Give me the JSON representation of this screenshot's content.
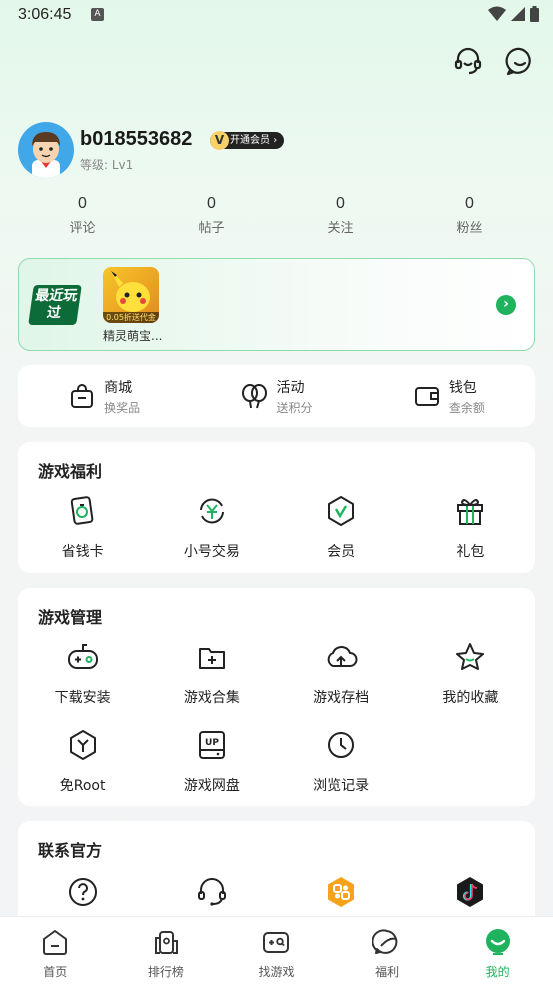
{
  "status": {
    "time": "3:06:45",
    "a_icon": "A"
  },
  "profile": {
    "username": "b018553682",
    "vip_label": "开通会员",
    "level": "等级: Lv1"
  },
  "stats": [
    {
      "value": "0",
      "label": "评论"
    },
    {
      "value": "0",
      "label": "帖子"
    },
    {
      "value": "0",
      "label": "关注"
    },
    {
      "value": "0",
      "label": "粉丝"
    }
  ],
  "recent": {
    "logo_text": "最近玩过",
    "game_name": "精灵萌宝...",
    "game_tag": "0.05折送代金"
  },
  "shop": [
    {
      "title": "商城",
      "sub": "换奖品",
      "icon": "shopping-bag-icon"
    },
    {
      "title": "活动",
      "sub": "送积分",
      "icon": "balloons-icon"
    },
    {
      "title": "钱包",
      "sub": "查余额",
      "icon": "wallet-icon"
    }
  ],
  "welfare": {
    "title": "游戏福利",
    "items": [
      {
        "label": "省钱卡",
        "icon": "money-card-icon"
      },
      {
        "label": "小号交易",
        "icon": "yuan-exchange-icon"
      },
      {
        "label": "会员",
        "icon": "vip-shield-icon"
      },
      {
        "label": "礼包",
        "icon": "gift-icon"
      }
    ]
  },
  "manage": {
    "title": "游戏管理",
    "items": [
      {
        "label": "下载安装",
        "icon": "gamepad-icon"
      },
      {
        "label": "游戏合集",
        "icon": "folder-plus-icon"
      },
      {
        "label": "游戏存档",
        "icon": "cloud-upload-icon"
      },
      {
        "label": "我的收藏",
        "icon": "star-icon"
      },
      {
        "label": "免Root",
        "icon": "root-hex-icon"
      },
      {
        "label": "游戏网盘",
        "icon": "up-disk-icon"
      },
      {
        "label": "浏览记录",
        "icon": "clock-icon"
      }
    ]
  },
  "contact": {
    "title": "联系官方"
  },
  "nav": [
    {
      "label": "首页",
      "icon": "home-icon"
    },
    {
      "label": "排行榜",
      "icon": "ranking-icon"
    },
    {
      "label": "找游戏",
      "icon": "find-game-icon"
    },
    {
      "label": "福利",
      "icon": "welfare-icon"
    },
    {
      "label": "我的",
      "icon": "me-icon"
    }
  ],
  "colors": {
    "accent": "#1fb35e",
    "badge_gold": "#f6d16a"
  }
}
